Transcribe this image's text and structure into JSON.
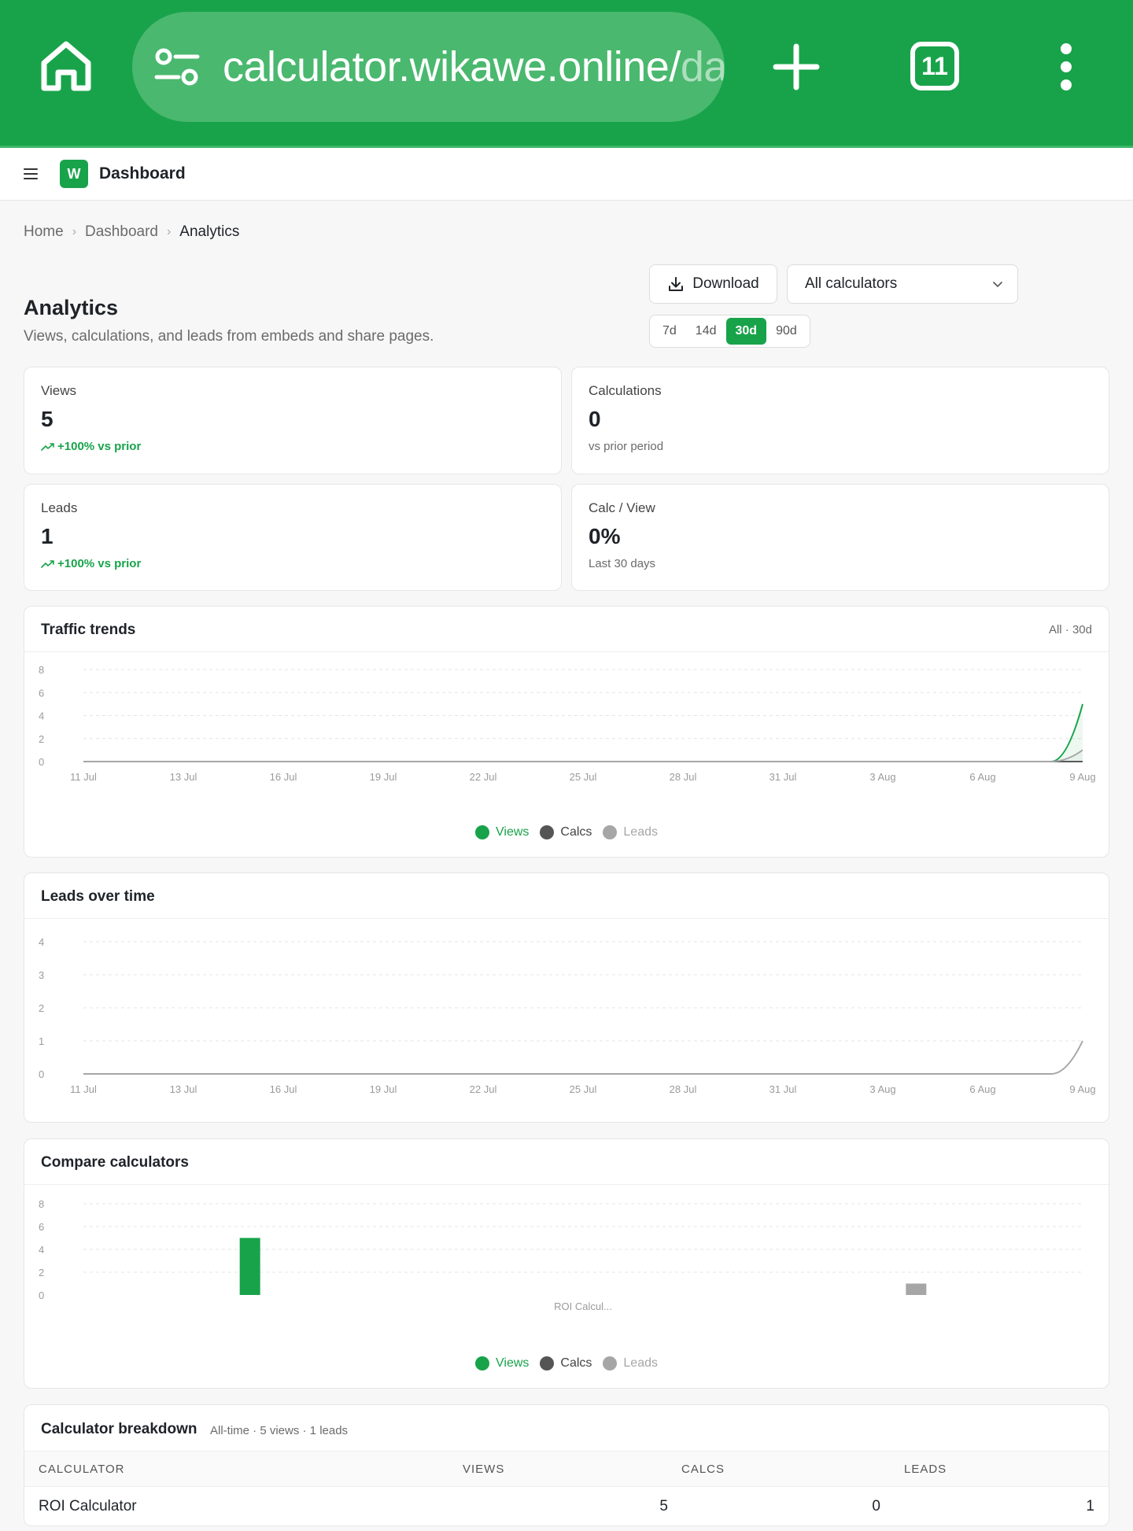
{
  "browser": {
    "url_main": "calculator.wikawe.online/",
    "url_faded": "da",
    "tab_count": "11",
    "icons": [
      "home-icon",
      "site-settings-icon",
      "new-tab-icon",
      "tab-switcher-icon",
      "more-icon"
    ]
  },
  "header": {
    "logo_letter": "W",
    "title": "Dashboard"
  },
  "breadcrumb": [
    "Home",
    "Dashboard",
    "Analytics"
  ],
  "page": {
    "title": "Analytics",
    "subtitle": "Views, calculations, and leads from embeds and share pages."
  },
  "toolbar": {
    "download_label": "Download",
    "calculator_select": "All calculators",
    "ranges": [
      "7d",
      "14d",
      "30d",
      "90d"
    ],
    "active_range": "30d"
  },
  "stats": [
    {
      "label": "Views",
      "value": "5",
      "foot": "+100% vs prior",
      "trend": "up"
    },
    {
      "label": "Calculations",
      "value": "0",
      "foot": "vs prior period",
      "trend": "none"
    },
    {
      "label": "Leads",
      "value": "1",
      "foot": "+100% vs prior",
      "trend": "up"
    },
    {
      "label": "Calc / View",
      "value": "0%",
      "foot": "Last 30 days",
      "trend": "none"
    }
  ],
  "colors": {
    "brand": "#18a34a",
    "views": "#18a34a",
    "calcs": "#555555",
    "leads": "#a6a6a6"
  },
  "legend": [
    {
      "name": "Views",
      "color": "#18a34a",
      "text_color": "#18a34a"
    },
    {
      "name": "Calcs",
      "color": "#555555",
      "text_color": "#444444"
    },
    {
      "name": "Leads",
      "color": "#a6a6a6",
      "text_color": "#a6a6a6"
    }
  ],
  "traffic_card": {
    "title": "Traffic trends",
    "meta": "All · 30d"
  },
  "leads_card": {
    "title": "Leads over time"
  },
  "compare_card": {
    "title": "Compare calculators"
  },
  "breakdown": {
    "title": "Calculator breakdown",
    "meta": "All-time · 5 views · 1 leads",
    "columns": [
      "CALCULATOR",
      "VIEWS",
      "CALCS",
      "LEADS"
    ],
    "rows": [
      {
        "calculator": "ROI Calculator",
        "views": "5",
        "calcs": "0",
        "leads": "1"
      }
    ]
  },
  "chart_data": [
    {
      "type": "area",
      "x_labels": [
        "11 Jul",
        "13 Jul",
        "16 Jul",
        "19 Jul",
        "22 Jul",
        "25 Jul",
        "28 Jul",
        "31 Jul",
        "3 Aug",
        "6 Aug",
        "9 Aug"
      ],
      "yticks": [
        0,
        2,
        4,
        6,
        8
      ],
      "ylim": [
        0,
        8
      ],
      "series": [
        {
          "name": "Views",
          "final": 5
        },
        {
          "name": "Calcs",
          "final": 0
        },
        {
          "name": "Leads",
          "final": 1
        }
      ],
      "grid": true,
      "legend": "bottom"
    },
    {
      "type": "line",
      "x_labels": [
        "11 Jul",
        "13 Jul",
        "16 Jul",
        "19 Jul",
        "22 Jul",
        "25 Jul",
        "28 Jul",
        "31 Jul",
        "3 Aug",
        "6 Aug",
        "9 Aug"
      ],
      "yticks": [
        0,
        1,
        2,
        3,
        4
      ],
      "ylim": [
        0,
        4
      ],
      "series": [
        {
          "name": "Leads",
          "final": 1
        }
      ],
      "grid": true
    },
    {
      "type": "bar",
      "categories": [
        "ROI Calcul..."
      ],
      "yticks": [
        0,
        2,
        4,
        6,
        8
      ],
      "ylim": [
        0,
        8
      ],
      "series": [
        {
          "name": "Views",
          "values": [
            5
          ]
        },
        {
          "name": "Calcs",
          "values": [
            0
          ]
        },
        {
          "name": "Leads",
          "values": [
            1
          ]
        }
      ],
      "grid": true,
      "legend": "bottom"
    }
  ]
}
